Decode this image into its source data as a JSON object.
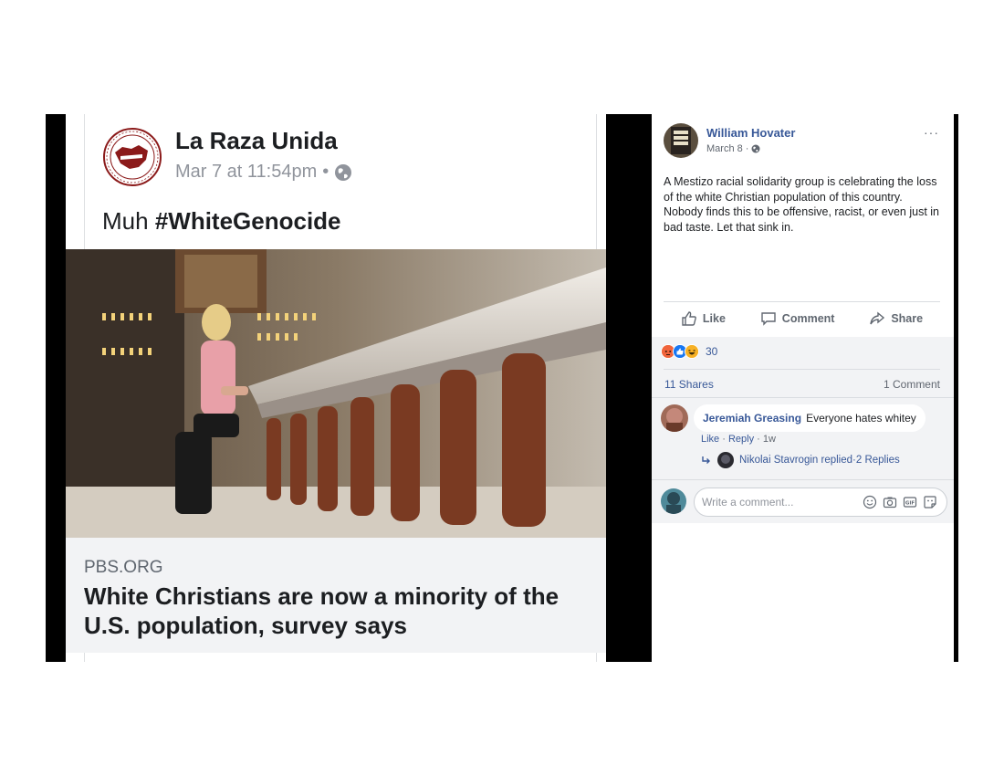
{
  "left_post": {
    "page_name": "La Raza Unida",
    "date": "Mar 7 at 11:54pm",
    "date_separator": "•",
    "text_prefix": "Muh ",
    "hashtag": "#WhiteGenocide",
    "link": {
      "domain": "PBS.ORG",
      "title": "White Christians are now a minority of the U.S. population, survey says"
    }
  },
  "right_post": {
    "author": "William Hovater",
    "date": "March 8 ·",
    "more_label": "···",
    "text": "A Mestizo racial solidarity group is celebrating the loss of the white Christian population of this country. Nobody finds this to be offensive, racist, or even just in bad taste. Let that sink in.",
    "actions": {
      "like": "Like",
      "comment": "Comment",
      "share": "Share"
    },
    "reaction_count": "30",
    "reaction_icons": [
      "angry-icon",
      "like-icon",
      "haha-icon"
    ],
    "shares": "11 Shares",
    "comments_count": "1 Comment",
    "comment": {
      "author": "Jeremiah Greasing",
      "text": "Everyone hates whitey",
      "like": "Like",
      "dot1": " · ",
      "reply": "Reply",
      "time": " · 1w"
    },
    "reply_summary": {
      "text": "Nikolai Stavrogin replied",
      "sep": " · ",
      "count": "2 Replies"
    },
    "write_placeholder": "Write a comment..."
  },
  "colors": {
    "facebook_link": "#385898",
    "secondary_text": "#616770",
    "gray_bg": "#f2f3f5",
    "logo_red": "#8b1a1a"
  }
}
